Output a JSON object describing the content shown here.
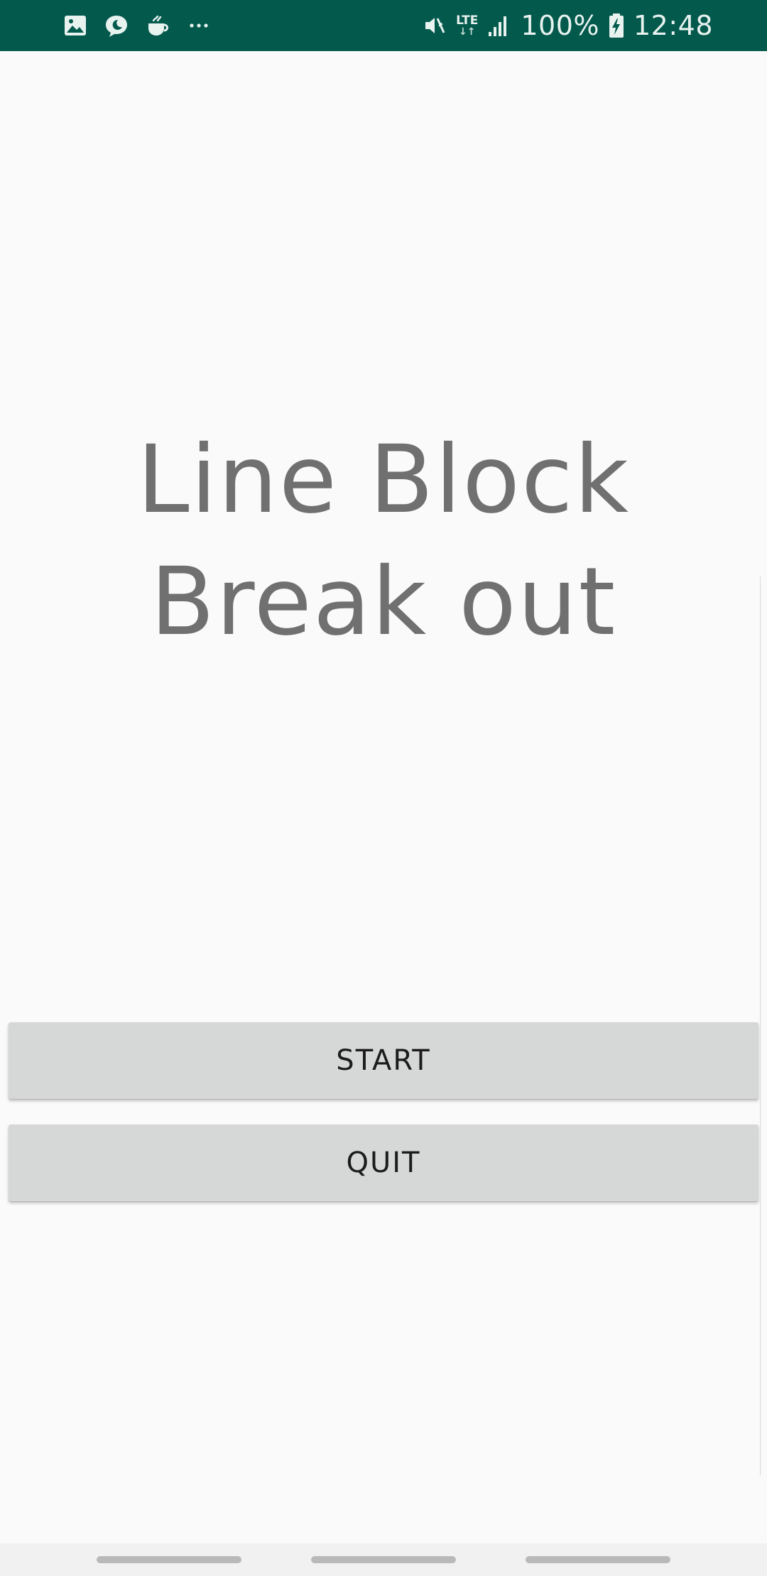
{
  "status_bar": {
    "background": "#02594c",
    "left_icons": [
      "gallery-icon",
      "chat-bubble-icon",
      "coffee-cup-icon",
      "more-dots-icon"
    ],
    "network": "LTE",
    "battery_percent": "100%",
    "time": "12:48"
  },
  "app": {
    "title_line1": "Line Block",
    "title_line2": "Break out"
  },
  "buttons": {
    "start_label": "START",
    "quit_label": "QUIT"
  },
  "colors": {
    "title_text": "#707070",
    "button_bg": "#d6d7d7",
    "page_bg": "#fafafa"
  }
}
